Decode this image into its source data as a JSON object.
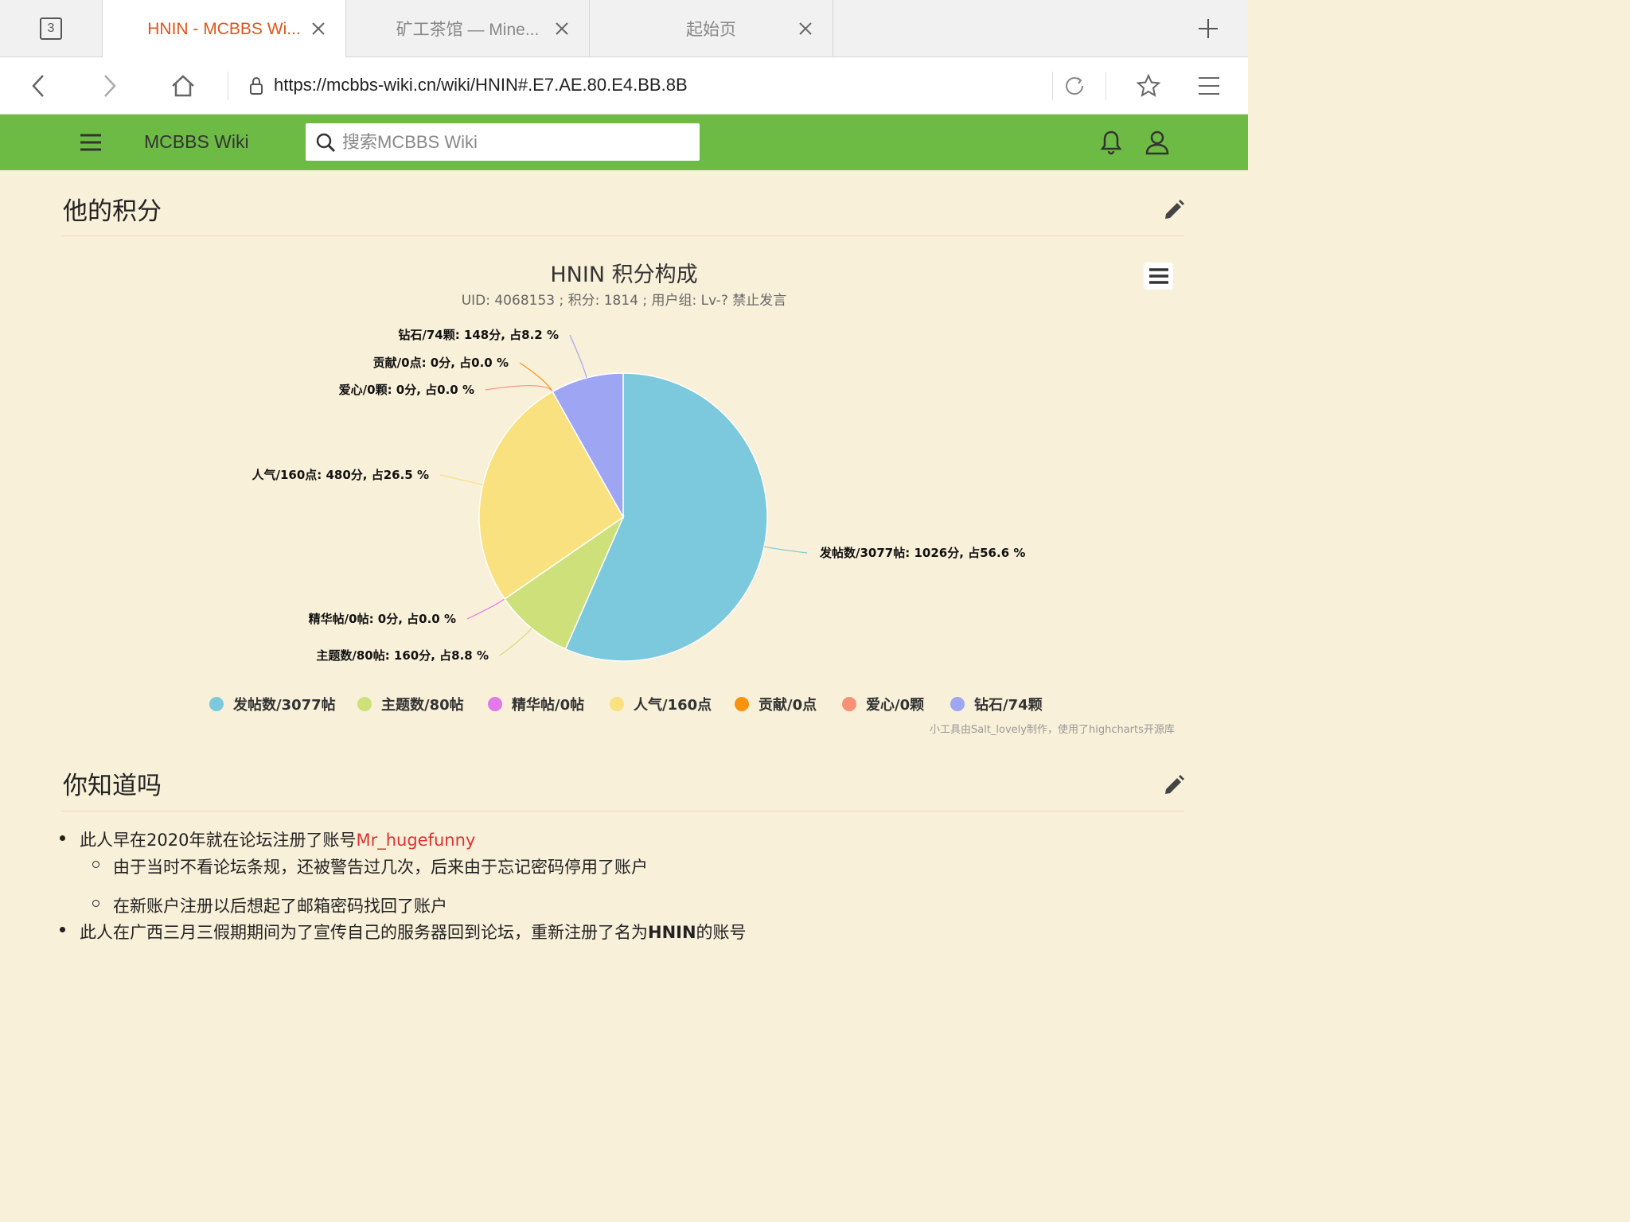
{
  "browser": {
    "tab_count": "3",
    "tabs": [
      {
        "title": "HNIN - MCBBS Wi..."
      },
      {
        "title": "矿工茶馆 — Mine..."
      },
      {
        "title": "起始页"
      }
    ],
    "url": "https://mcbbs-wiki.cn/wiki/HNIN#.E7.AE.80.E4.BB.8B"
  },
  "site": {
    "name": "MCBBS Wiki",
    "search_placeholder": "搜索MCBBS Wiki"
  },
  "sections": {
    "score_title": "他的积分",
    "dyk_title": "你知道吗"
  },
  "chart_data": {
    "type": "pie",
    "title": "HNIN 积分构成",
    "subtitle": "UID: 4068153 ; 积分: 1814 ; 用户组: Lv-? 禁止发言",
    "slices": [
      {
        "name": "发帖数/3077帖",
        "label": "发帖数/3077帖: 1026分, 占56.6 %",
        "value": 1026,
        "percent": 56.6,
        "color": "#7cc9dd"
      },
      {
        "name": "主题数/80帖",
        "label": "主题数/80帖: 160分, 占8.8 %",
        "value": 160,
        "percent": 8.8,
        "color": "#cde07a"
      },
      {
        "name": "精华帖/0帖",
        "label": "精华帖/0帖: 0分, 占0.0 %",
        "value": 0,
        "percent": 0.0,
        "color": "#e17ae8"
      },
      {
        "name": "人气/160点",
        "label": "人气/160点: 480分, 占26.5 %",
        "value": 480,
        "percent": 26.5,
        "color": "#fae180"
      },
      {
        "name": "贡献/0点",
        "label": "贡献/0点: 0分, 占0.0 %",
        "value": 0,
        "percent": 0.0,
        "color": "#f7930f"
      },
      {
        "name": "爱心/0颗",
        "label": "爱心/0颗: 0分, 占0.0 %",
        "value": 0,
        "percent": 0.0,
        "color": "#f99177"
      },
      {
        "name": "钻石/74颗",
        "label": "钻石/74颗: 148分, 占8.2 %",
        "value": 148,
        "percent": 8.2,
        "color": "#9ea6f4"
      }
    ],
    "legend": "bottom",
    "credit": "小工具由Salt_lovely制作，使用了highcharts开源库"
  },
  "facts": {
    "f1_text": "此人早在2020年就在论坛注册了账号",
    "f1_link": "Mr_hugefunny",
    "f1a": "由于当时不看论坛条规，还被警告过几次，后来由于忘记密码停用了账户",
    "f1b": "在新账户注册以后想起了邮箱密码找回了账户",
    "f2_text": "此人在广西三月三假期期间为了宣传自己的服务器回到论坛，重新注册了名为",
    "f2_bold": "HNIN",
    "f2_end": "的账号"
  }
}
